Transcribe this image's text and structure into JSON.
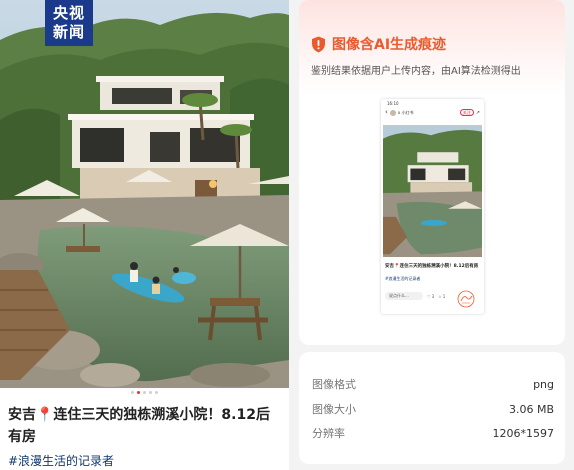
{
  "logo": {
    "line1": "央视",
    "line2": "新闻"
  },
  "post": {
    "title": "安吉📍连住三天的独栋溯溪小院！8.12后有房",
    "hashtag": "#浪漫生活的记录者",
    "carousel": {
      "count": 5,
      "active_index": 1
    }
  },
  "detection": {
    "title": "图像含AI生成痕迹",
    "description": "鉴别结果依据用户上传内容，由AI算法检测得出",
    "icon": "shield-warning-icon",
    "accent_color": "#ea5a2e"
  },
  "thumbnail": {
    "status_time": "16:10",
    "author": "x 小红书",
    "follow_label": "关注",
    "share_icon": "share-icon",
    "title": "安吉📍连住三天的独栋溯溪小院！8.12后有房",
    "hashtag": "#浪漫生活的记录者",
    "comment_placeholder": "说点什么...",
    "likes": "3",
    "stars": "1"
  },
  "image_info": {
    "format_label": "图像格式",
    "format_value": "png",
    "size_label": "图像大小",
    "size_value": "3.06 MB",
    "resolution_label": "分辨率",
    "resolution_value": "1206*1597"
  }
}
